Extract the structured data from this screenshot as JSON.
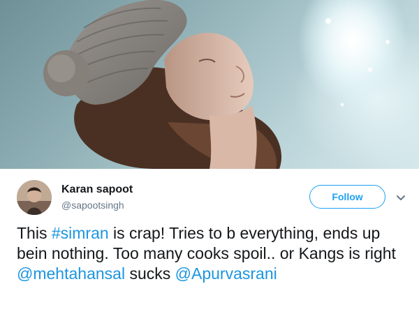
{
  "tweet": {
    "author_name": "Karan sapoot",
    "author_handle": "@sapootsingh",
    "follow_label": "Follow",
    "text": {
      "part1": "This ",
      "hashtag": "#simran",
      "part2": " is crap! Tries to b everything, ends up bein nothing. Too many cooks spoil.. or Kangs is right ",
      "mention1": "@mehtahansal",
      "part3": " sucks ",
      "mention2": "@Apurvasrani"
    }
  },
  "icons": {
    "more": "chevron-down-icon"
  },
  "colors": {
    "link": "#1b95e0",
    "follow": "#1da1f2",
    "text": "#14171a",
    "muted": "#657786"
  }
}
